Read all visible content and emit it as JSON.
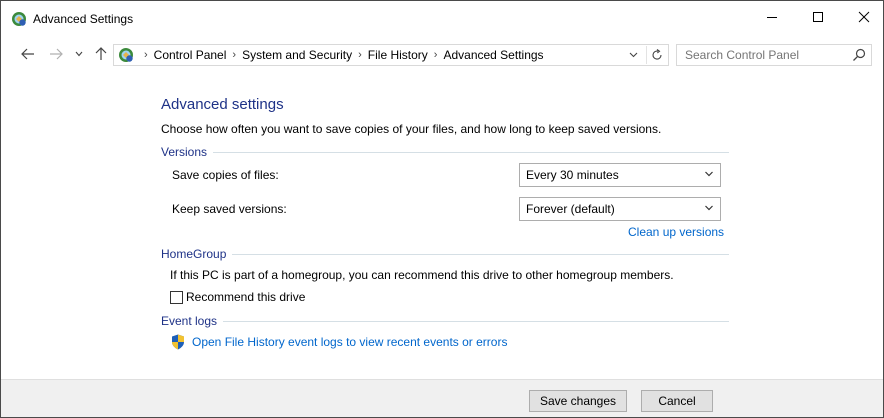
{
  "window": {
    "title": "Advanced Settings",
    "controls": {
      "minimize": "—",
      "maximize": "☐",
      "close": "✕"
    }
  },
  "address": {
    "breadcrumbs": [
      "Control Panel",
      "System and Security",
      "File History",
      "Advanced Settings"
    ],
    "separator": "›"
  },
  "search": {
    "placeholder": "Search Control Panel"
  },
  "main": {
    "heading": "Advanced settings",
    "intro": "Choose how often you want to save copies of your files, and how long to keep saved versions.",
    "versions": {
      "title": "Versions",
      "save_copies_label": "Save copies of files:",
      "save_copies_value": "Every 30 minutes",
      "keep_versions_label": "Keep saved versions:",
      "keep_versions_value": "Forever (default)",
      "clean_up_link": "Clean up versions"
    },
    "homegroup": {
      "title": "HomeGroup",
      "description": "If this PC is part of a homegroup, you can recommend this drive to other homegroup members.",
      "recommend_label": "Recommend this drive",
      "recommend_checked": false
    },
    "event_logs": {
      "title": "Event logs",
      "link": "Open File History event logs to view recent events or errors"
    }
  },
  "footer": {
    "save_label": "Save changes",
    "cancel_label": "Cancel"
  },
  "colors": {
    "heading": "#1e3287",
    "link": "#0066cc",
    "footer_bg": "#f0f0f0"
  }
}
